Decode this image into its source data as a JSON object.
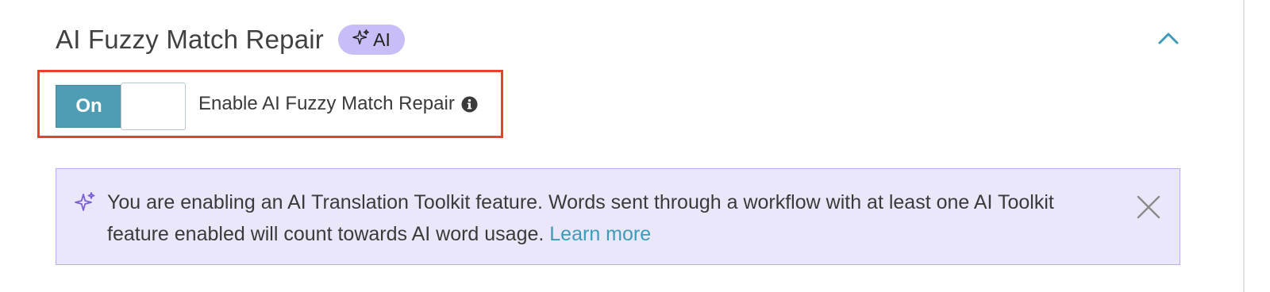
{
  "section": {
    "title": "AI Fuzzy Match Repair",
    "badge_label": "AI",
    "badge_icon": "sparkle-icon",
    "collapse_icon": "chevron-up-icon"
  },
  "toggle": {
    "state_label": "On",
    "enabled": true,
    "label": "Enable AI Fuzzy Match Repair",
    "info_icon": "info-icon"
  },
  "notice": {
    "icon": "sparkle-icon",
    "message": "You are enabling an AI Translation Toolkit feature. Words sent through a workflow with at least one AI Toolkit feature enabled will count towards AI word usage.",
    "link_label": "Learn more",
    "close_icon": "close-icon"
  },
  "colors": {
    "toggle_on": "#4e9db4",
    "badge_bg": "#c8bdf6",
    "notice_bg": "#ebe7fb",
    "notice_border": "#b7aef0",
    "highlight": "#e34527",
    "link": "#3d9bb8"
  }
}
